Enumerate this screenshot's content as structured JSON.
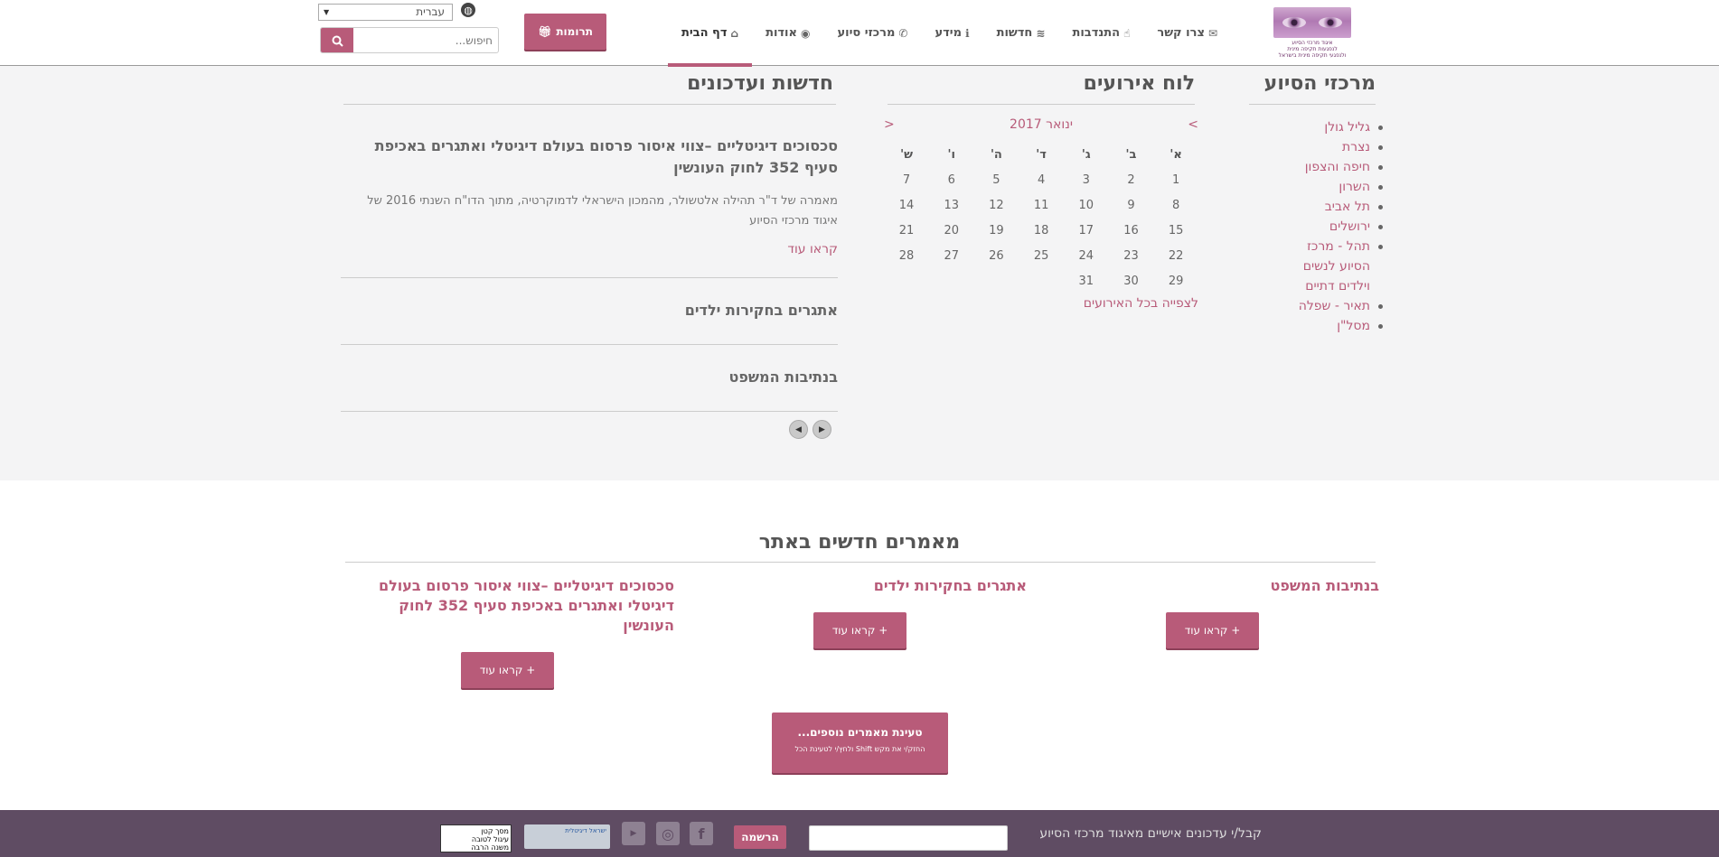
{
  "logo": {
    "line1": "איגוד מרכזי הסיוע",
    "line2": "לנפגעות תקיפה מינית",
    "line3": "ולנפגעי תקיפה מינית בישראל"
  },
  "nav": [
    {
      "label": "דף הבית",
      "icon": "home-icon",
      "glyph": "⌂",
      "active": true
    },
    {
      "label": "אודות",
      "icon": "eye-icon",
      "glyph": "◉"
    },
    {
      "label": "מרכזי סיוע",
      "icon": "phone-icon",
      "glyph": "✆"
    },
    {
      "label": "מידע",
      "icon": "info-icon",
      "glyph": "ℹ"
    },
    {
      "label": "חדשות",
      "icon": "rss-icon",
      "glyph": "≋"
    },
    {
      "label": "התנדבות",
      "icon": "thumbs-up-icon",
      "glyph": "☝"
    },
    {
      "label": "צרו קשר",
      "icon": "envelope-icon",
      "glyph": "✉"
    }
  ],
  "donate": {
    "label": "תרומות",
    "icon": "gift-icon"
  },
  "language": {
    "selected": "עברית"
  },
  "search": {
    "placeholder": "חיפוש..."
  },
  "centers": {
    "title": "מרכזי הסיוע",
    "items": [
      {
        "label": "גליל גולן"
      },
      {
        "label": "נצרת"
      },
      {
        "label": "חיפה והצפון"
      },
      {
        "label": "השרון"
      },
      {
        "label": "תל אביב"
      },
      {
        "label": "ירושלים"
      },
      {
        "label": "תהל - מרכז",
        "cont": [
          "הסיוע לנשים",
          "וילדים דתיים"
        ]
      },
      {
        "label": "תאיר - שפלה"
      },
      {
        "label": "מסל\"ן"
      }
    ]
  },
  "calendar": {
    "title": "לוח אירועים",
    "month": "ינואר 2017",
    "prev": "<",
    "next": ">",
    "day_names": [
      "א'",
      "ב'",
      "ג'",
      "ד'",
      "ה'",
      "ו'",
      "ש'"
    ],
    "weeks": [
      [
        "1",
        "2",
        "3",
        "4",
        "5",
        "6",
        "7"
      ],
      [
        "8",
        "9",
        "10",
        "11",
        "12",
        "13",
        "14"
      ],
      [
        "15",
        "16",
        "17",
        "18",
        "19",
        "20",
        "21"
      ],
      [
        "22",
        "23",
        "24",
        "25",
        "26",
        "27",
        "28"
      ],
      [
        "29",
        "30",
        "31",
        "",
        "",
        "",
        ""
      ]
    ],
    "all_events": "לצפייה בכל האירועים"
  },
  "news": {
    "title": "חדשות ועדכונים",
    "featured": {
      "heading": "סכסוכים דיגיטליים –צווי איסור פרסום בעולם דיגיטלי ואתגרים באכיפת סעיף 352 לחוק העונשין",
      "excerpt": "מאמרה של ד\"ר תהילה אלטשולר, מהמכון הישראלי לדמוקרטיה, מתוך הדו\"ח השנתי 2016 של איגוד מרכזי הסיוע",
      "more": "קראו עוד"
    },
    "item2": "אתגרים בחקירות ילדים",
    "item3": "בנתיבות המשפט"
  },
  "articles": {
    "title": "מאמרים חדשים באתר",
    "items": [
      {
        "title": "בנתיבות המשפט",
        "button": "+ קראו עוד"
      },
      {
        "title": "אתגרים בחקירות ילדים",
        "button": "+ קראו עוד"
      },
      {
        "title": "סכסוכים דיגיטליים –צווי איסור פרסום בעולם דיגיטלי ואתגרים באכיפת סעיף 352 לחוק העונשין",
        "button": "+ קראו עוד"
      }
    ],
    "load_more": "טעינת מאמרים נוספים...",
    "load_more_hint": "החזק/י את מקש Shift ולחץ/י לטעינת הכל"
  },
  "footer": {
    "subscribe_label": "קבל/י עדכונים אישיים מאיגוד מרכזי הסיוע",
    "subscribe_button": "הרשמה",
    "badge1": "ישראל דיגיטלית",
    "badge2_line1": "מסך קטן",
    "badge2_line2": "עיגול לטובה",
    "badge2_line3": "משנה הרבה"
  },
  "colors": {
    "accent": "#b85b79",
    "footer": "#5f4c63",
    "page_bg": "#f4f4f5"
  }
}
